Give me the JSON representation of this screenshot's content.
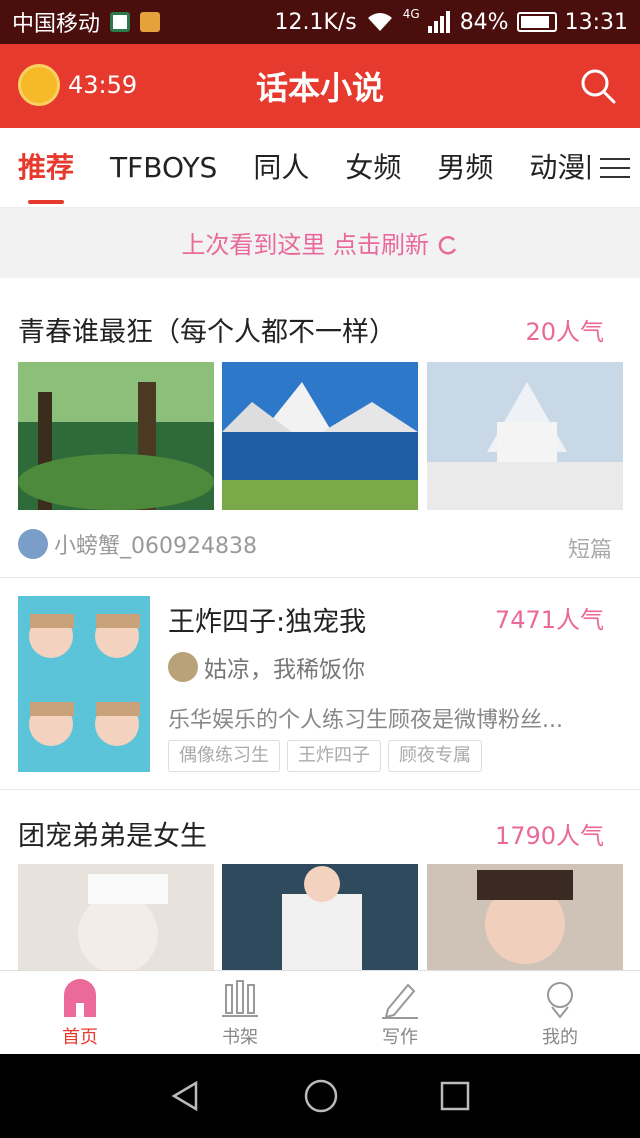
{
  "status_bar": {
    "carrier": "中国移动",
    "speed": "12.1K/s",
    "network": "4G",
    "battery": "84%",
    "time": "13:31"
  },
  "header": {
    "timer": "43:59",
    "title": "话本小说",
    "search_icon": "search-icon"
  },
  "tabs": [
    {
      "label": "推荐",
      "active": true
    },
    {
      "label": "TFBOYS",
      "active": false
    },
    {
      "label": "同人",
      "active": false
    },
    {
      "label": "女频",
      "active": false
    },
    {
      "label": "男频",
      "active": false
    },
    {
      "label": "动漫同",
      "active": false
    }
  ],
  "refresh_bar": {
    "text": "上次看到这里 点击刷新"
  },
  "cards": [
    {
      "title": "青春谁最狂（每个人都不一样）",
      "popularity": "20人气",
      "author": "小螃蟹_060924838",
      "genre": "短篇"
    },
    {
      "title": "王炸四子:独宠我",
      "popularity": "7471人气",
      "author": "姑凉，我稀饭你",
      "description": "乐华娱乐的个人练习生顾夜是微博粉丝...",
      "tags": [
        "偶像练习生",
        "王炸四子",
        "顾夜专属"
      ]
    },
    {
      "title": "团宠弟弟是女生",
      "popularity": "1790人气"
    }
  ],
  "bottom_nav": [
    {
      "label": "首页",
      "icon": "home-icon",
      "active": true
    },
    {
      "label": "书架",
      "icon": "bookshelf-icon",
      "active": false
    },
    {
      "label": "写作",
      "icon": "pen-icon",
      "active": false
    },
    {
      "label": "我的",
      "icon": "profile-icon",
      "active": false
    }
  ],
  "colors": {
    "primary": "#e63a2e",
    "accent_pink": "#e96a9a",
    "status_bar": "#4a0f0d"
  }
}
